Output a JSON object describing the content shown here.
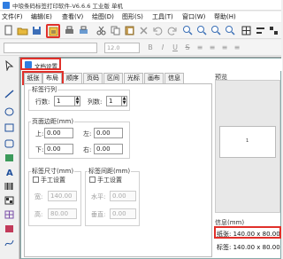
{
  "window": {
    "title": "中琅条码标签打印软件-V6.6.6 工业版 单机"
  },
  "menu": [
    {
      "id": "file",
      "label": "文件(F)"
    },
    {
      "id": "edit",
      "label": "编辑(E)"
    },
    {
      "id": "view",
      "label": "查看(V)"
    },
    {
      "id": "draw",
      "label": "绘图(D)"
    },
    {
      "id": "shape",
      "label": "图形(S)"
    },
    {
      "id": "tools",
      "label": "工具(T)"
    },
    {
      "id": "window",
      "label": "窗口(W)"
    },
    {
      "id": "help",
      "label": "帮助(H)"
    }
  ],
  "toolbar": {
    "font_size": "12.0"
  },
  "dialog": {
    "title": "文档设置",
    "tabs": [
      {
        "id": "paper",
        "label": "纸张"
      },
      {
        "id": "layout",
        "label": "布局"
      },
      {
        "id": "order",
        "label": "顺序"
      },
      {
        "id": "pagecode",
        "label": "页码"
      },
      {
        "id": "region",
        "label": "区间"
      },
      {
        "id": "cursor",
        "label": "光标"
      },
      {
        "id": "canvas",
        "label": "画布"
      },
      {
        "id": "info",
        "label": "信息"
      }
    ],
    "active_tab": "布局",
    "label_rows_cols": {
      "title": "标签行列",
      "rows_label": "行数:",
      "rows_value": "1",
      "cols_label": "列数:",
      "cols_value": "1"
    },
    "margins": {
      "title": "页面边距(mm)",
      "top_label": "上:",
      "top_value": "0.00",
      "left_label": "左:",
      "left_value": "0.00",
      "bottom_label": "下:",
      "bottom_value": "0.00",
      "right_label": "右:",
      "right_value": "0.00"
    },
    "label_size": {
      "title": "标签尺寸(mm)",
      "manual_label": "手工设置",
      "width_label": "宽:",
      "width_value": "140.00",
      "height_label": "高:",
      "height_value": "80.00"
    },
    "label_gap": {
      "title": "标签间距(mm)",
      "manual_label": "手工设置",
      "horizontal_label": "水平:",
      "horizontal_value": "0.00",
      "vertical_label": "垂直:",
      "vertical_value": "0.00"
    },
    "preview": {
      "title": "预览",
      "label_number": "1"
    },
    "info": {
      "title": "信息(mm)",
      "paper_line": "纸张: 140.00 x 80.00",
      "label_line": "标签: 140.00 x 80.00"
    }
  },
  "colors": {
    "highlight": "#e0302a",
    "accent": "#2f7de1"
  }
}
